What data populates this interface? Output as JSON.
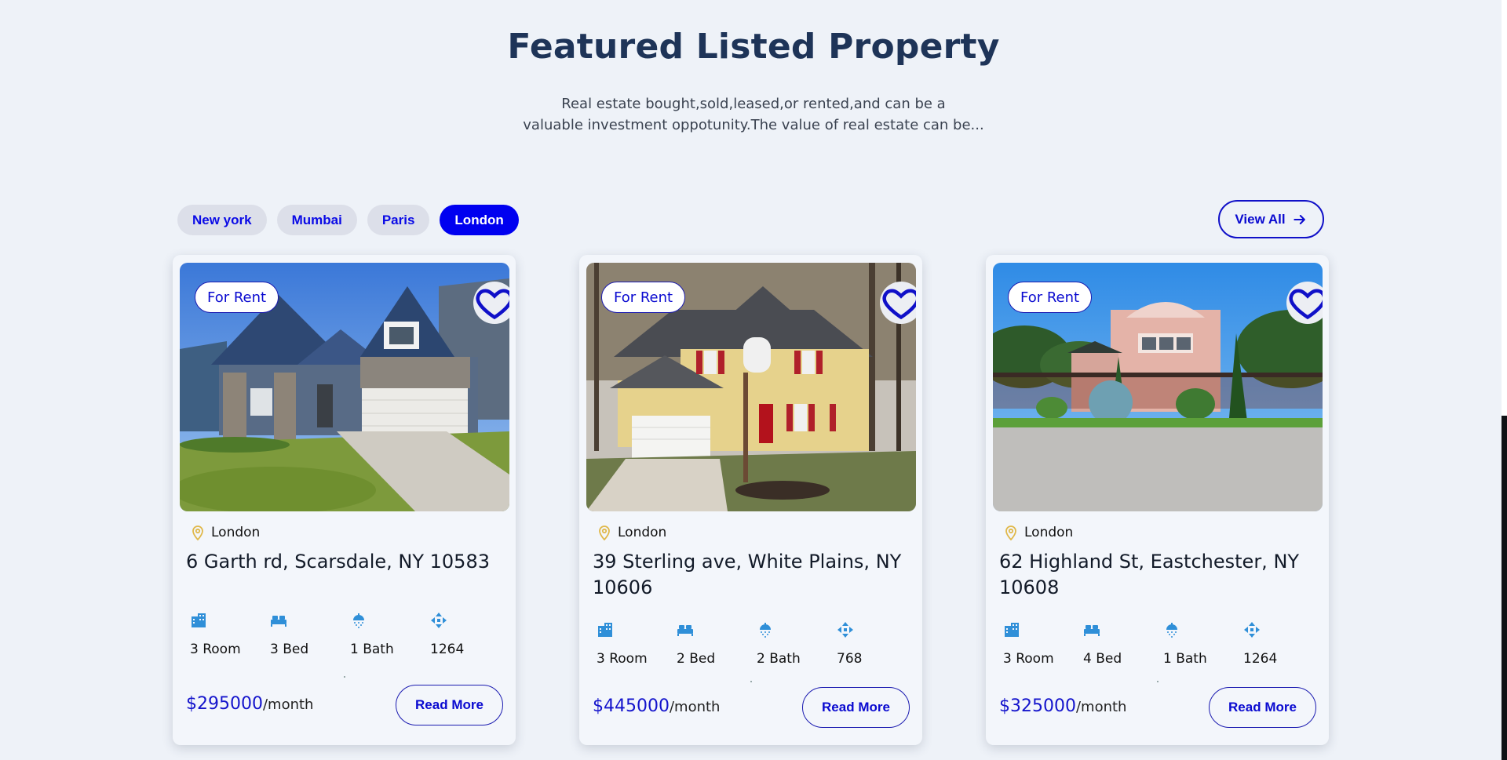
{
  "header": {
    "title": "Featured Listed Property",
    "subtitle_line1": "Real estate bought,sold,leased,or rented,and can be a",
    "subtitle_line2": "valuable investment oppotunity.The value of real estate can be..."
  },
  "filters": [
    {
      "label": "New york",
      "active": false
    },
    {
      "label": "Mumbai",
      "active": false
    },
    {
      "label": "Paris",
      "active": false
    },
    {
      "label": "London",
      "active": true
    }
  ],
  "view_all": {
    "label": "View All",
    "icon": "arrow-right-icon"
  },
  "colors": {
    "accent": "#0000f0",
    "icon_blue": "#2f8fd8",
    "pin": "#e0b84a",
    "price": "#1414cc"
  },
  "listings": [
    {
      "badge": "For Rent",
      "location": "London",
      "address": "6 Garth rd, Scarsdale, NY 10583",
      "features": {
        "rooms": "3 Room",
        "beds": "3 Bed",
        "baths": "1 Bath",
        "area": "1264"
      },
      "price": "$295000",
      "period": "/month",
      "cta": "Read More"
    },
    {
      "badge": "For Rent",
      "location": "London",
      "address": "39 Sterling ave, White Plains, NY 10606",
      "features": {
        "rooms": "3 Room",
        "beds": "2 Bed",
        "baths": "2 Bath",
        "area": "768"
      },
      "price": "$445000",
      "period": "/month",
      "cta": "Read More"
    },
    {
      "badge": "For Rent",
      "location": "London",
      "address": "62 Highland St, Eastchester, NY 10608",
      "features": {
        "rooms": "3 Room",
        "beds": "4 Bed",
        "baths": "1 Bath",
        "area": "1264"
      },
      "price": "$325000",
      "period": "/month",
      "cta": "Read More"
    }
  ]
}
